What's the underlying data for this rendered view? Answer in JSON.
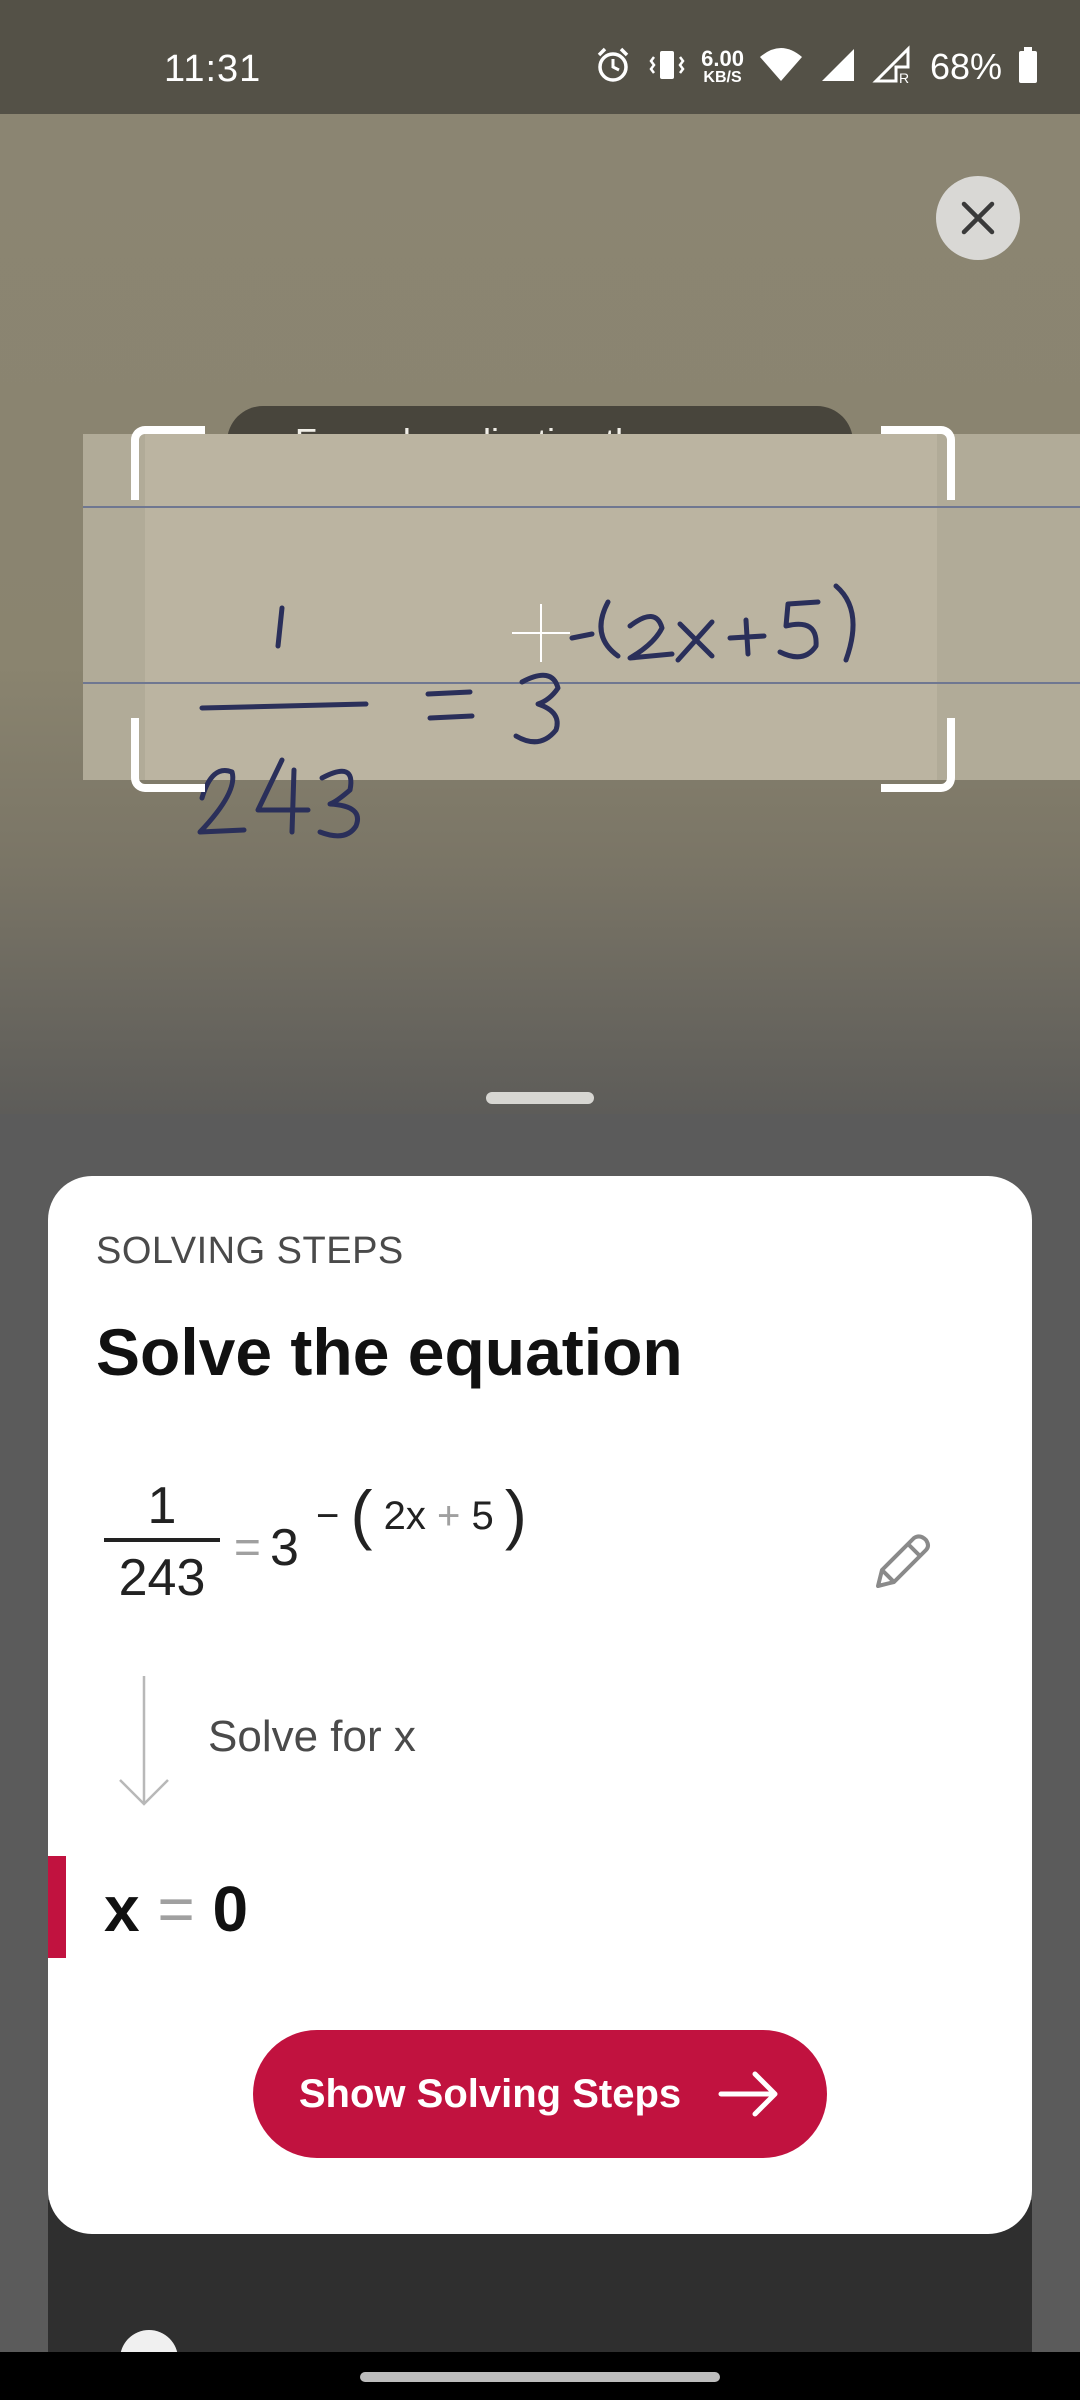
{
  "status_bar": {
    "time": "11:31",
    "net_speed_value": "6.00",
    "net_speed_unit": "KB/S",
    "battery_percent": "68%",
    "icons": [
      "alarm-icon",
      "vibrate-icon",
      "wifi-icon",
      "signal-icon",
      "signal-roaming-icon",
      "battery-icon"
    ]
  },
  "camera": {
    "hint": "Focus by adjusting the corners",
    "close_icon": "close-icon"
  },
  "card": {
    "section_label": "SOLVING STEPS",
    "title": "Solve the equation",
    "equation": {
      "numerator": "1",
      "denominator": "243",
      "equals": "=",
      "base": "3",
      "exp_minus": "−",
      "exp_open": "(",
      "exp_term1": "2x",
      "exp_plus": "+",
      "exp_term2": "5",
      "exp_close": ")"
    },
    "step_text": "Solve for x",
    "result": {
      "variable": "x",
      "equals": "=",
      "value": "0"
    },
    "button_label": "Show Solving Steps"
  },
  "colors": {
    "accent": "#c1123f",
    "status_bar_bg": "#545147",
    "card_bg": "#ffffff"
  }
}
